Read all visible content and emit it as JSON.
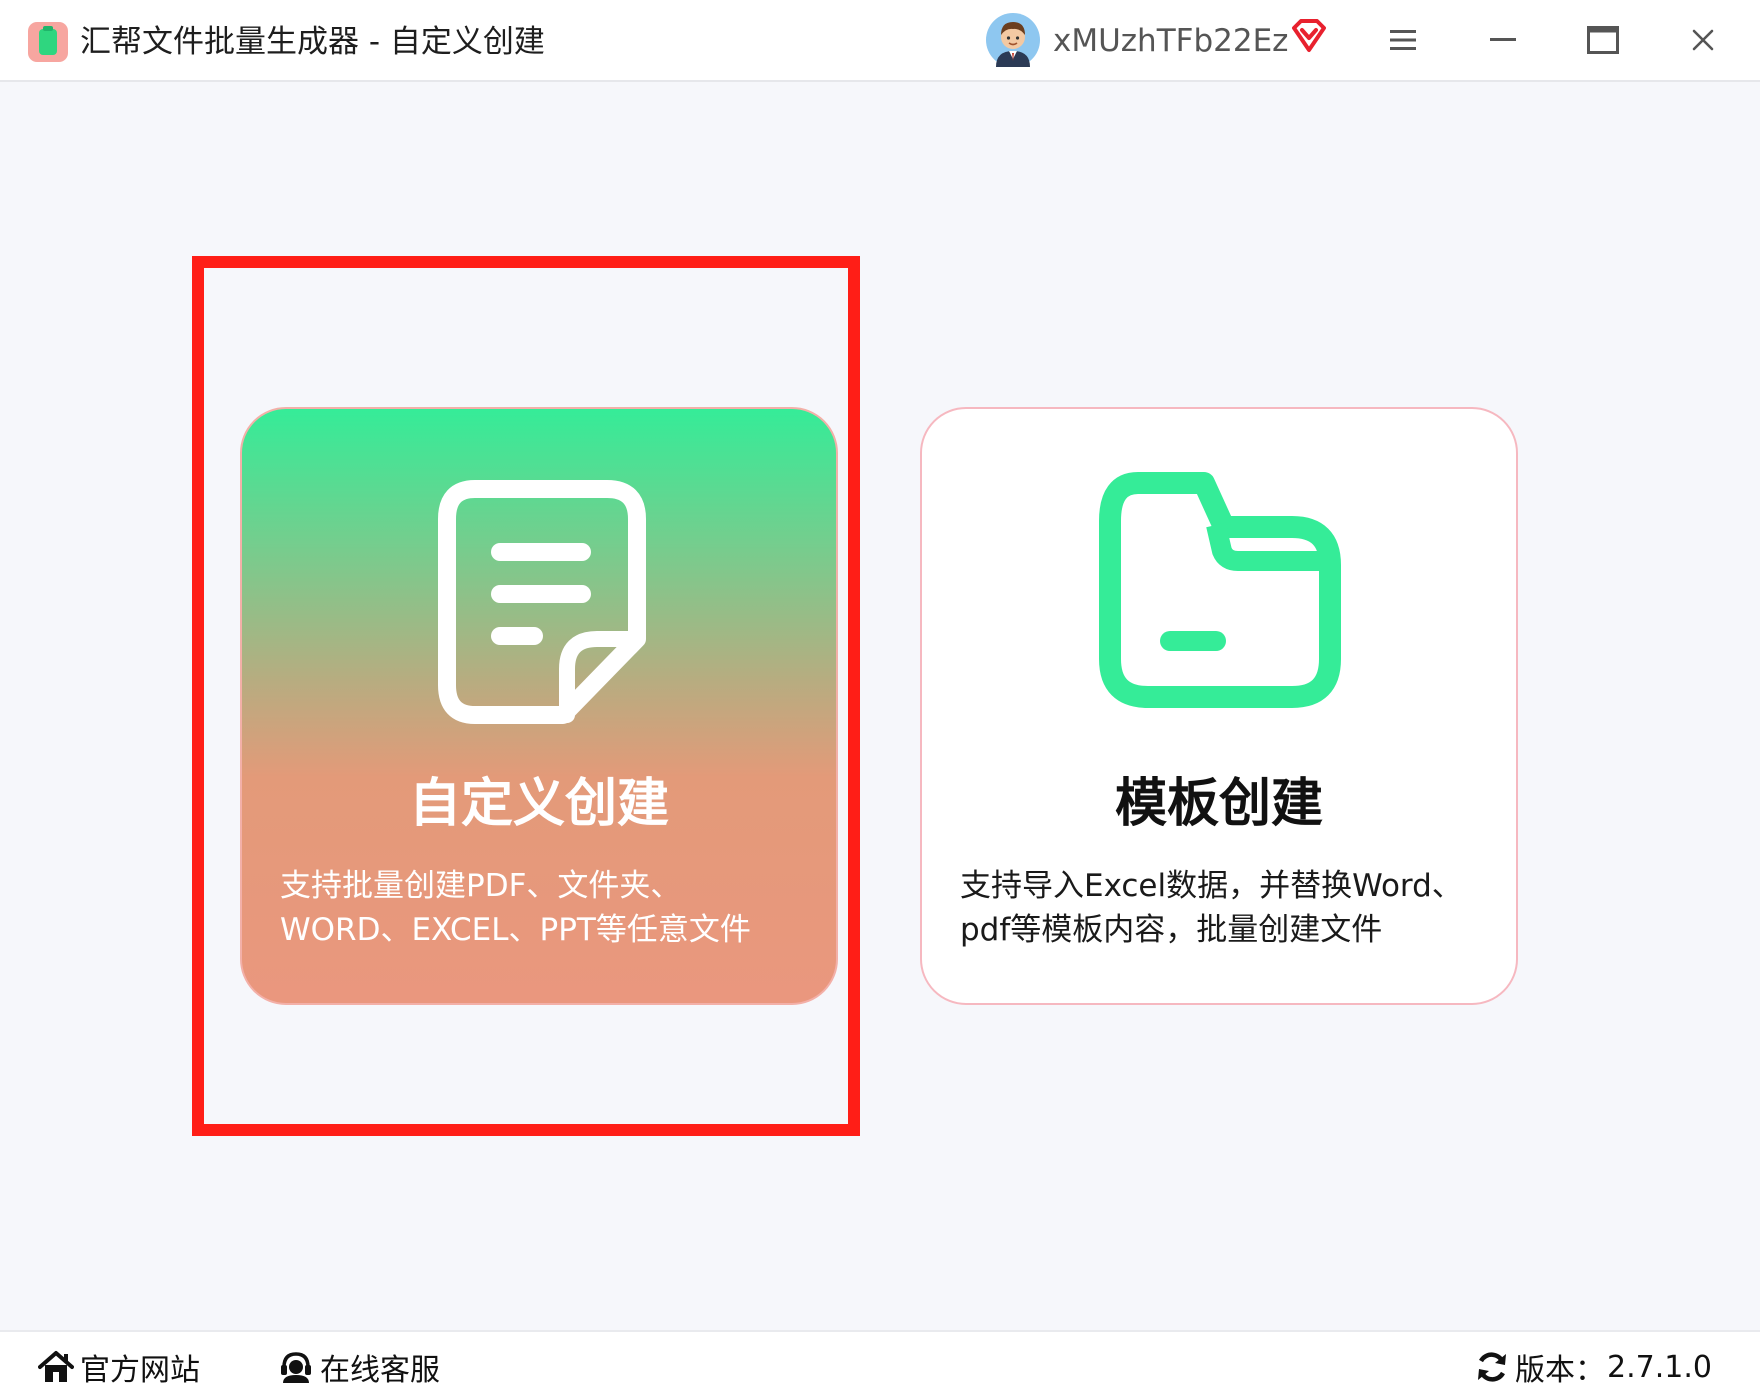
{
  "titlebar": {
    "title": "汇帮文件批量生成器 - 自定义创建",
    "username": "xMUzhTFb22Ez",
    "icons": {
      "app": "app-logo-icon",
      "avatar": "user-avatar",
      "vip": "vip-diamond-icon",
      "menu": "menu-icon",
      "minimize": "minimize-icon",
      "maximize": "maximize-icon",
      "close": "close-icon"
    }
  },
  "cards": {
    "custom": {
      "title": "自定义创建",
      "desc_line1": "支持批量创建PDF、文件夹、",
      "desc_line2": "WORD、EXCEL、PPT等任意文件",
      "icon": "document-icon"
    },
    "template": {
      "title": "模板创建",
      "desc_line1": "支持导入Excel数据，并替换Word、",
      "desc_line2": "pdf等模板内容，批量创建文件",
      "icon": "folder-icon"
    }
  },
  "footer": {
    "website_label": "官方网站",
    "service_label": "在线客服",
    "version_label": "版本：",
    "version_value": "2.7.1.0"
  },
  "colors": {
    "accent_green": "#35ec98",
    "highlight_red": "#ff1e17",
    "card_orange": "#ea977e",
    "card_border_pink": "#f6b8c0",
    "vip_red": "#e8212e"
  }
}
